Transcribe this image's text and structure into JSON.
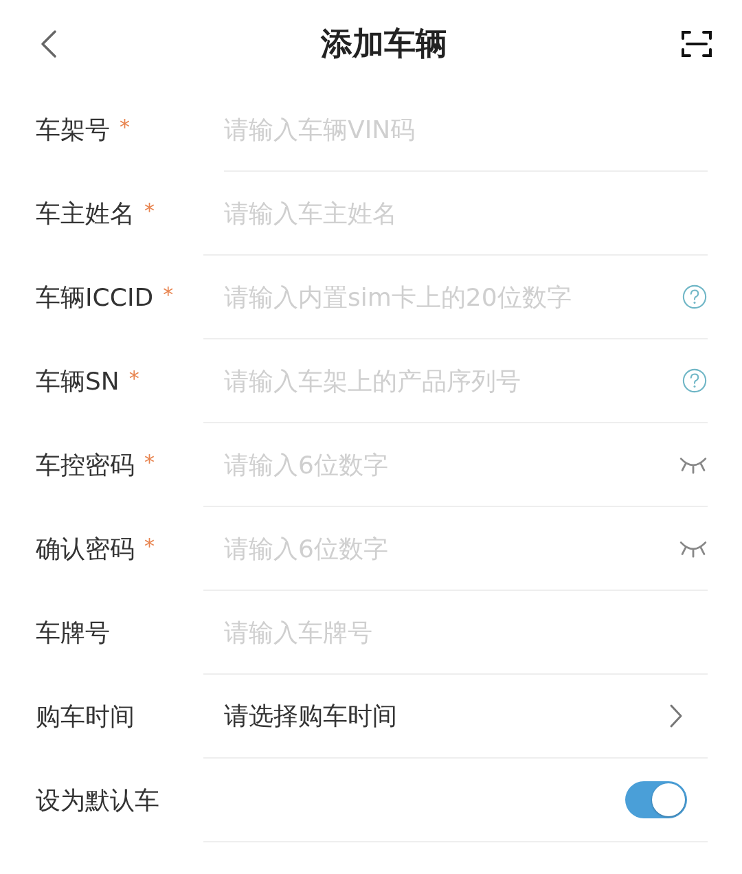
{
  "header": {
    "title": "添加车辆"
  },
  "rows": [
    {
      "kind": "input",
      "label": "车架号",
      "required_mark": "*",
      "placeholder": "请输入车辆VIN码"
    },
    {
      "kind": "input",
      "label": "车主姓名",
      "required_mark": "*",
      "placeholder": "请输入车主姓名"
    },
    {
      "kind": "help-input",
      "label": "车辆ICCID",
      "required_mark": "*",
      "placeholder": "请输入内置sim卡上的20位数字"
    },
    {
      "kind": "help-input",
      "label": "车辆SN",
      "required_mark": "*",
      "placeholder": "请输入车架上的产品序列号"
    },
    {
      "kind": "secret-input",
      "label": "车控密码",
      "required_mark": "*",
      "placeholder": "请输入6位数字"
    },
    {
      "kind": "secret-input",
      "label": "确认密码",
      "required_mark": "*",
      "placeholder": "请输入6位数字"
    },
    {
      "kind": "input",
      "label": "车牌号",
      "placeholder": "请输入车牌号"
    },
    {
      "kind": "picker",
      "label": "购车时间",
      "value": "请选择购车时间"
    },
    {
      "kind": "switch",
      "label": "设为默认车",
      "on": true
    }
  ]
}
